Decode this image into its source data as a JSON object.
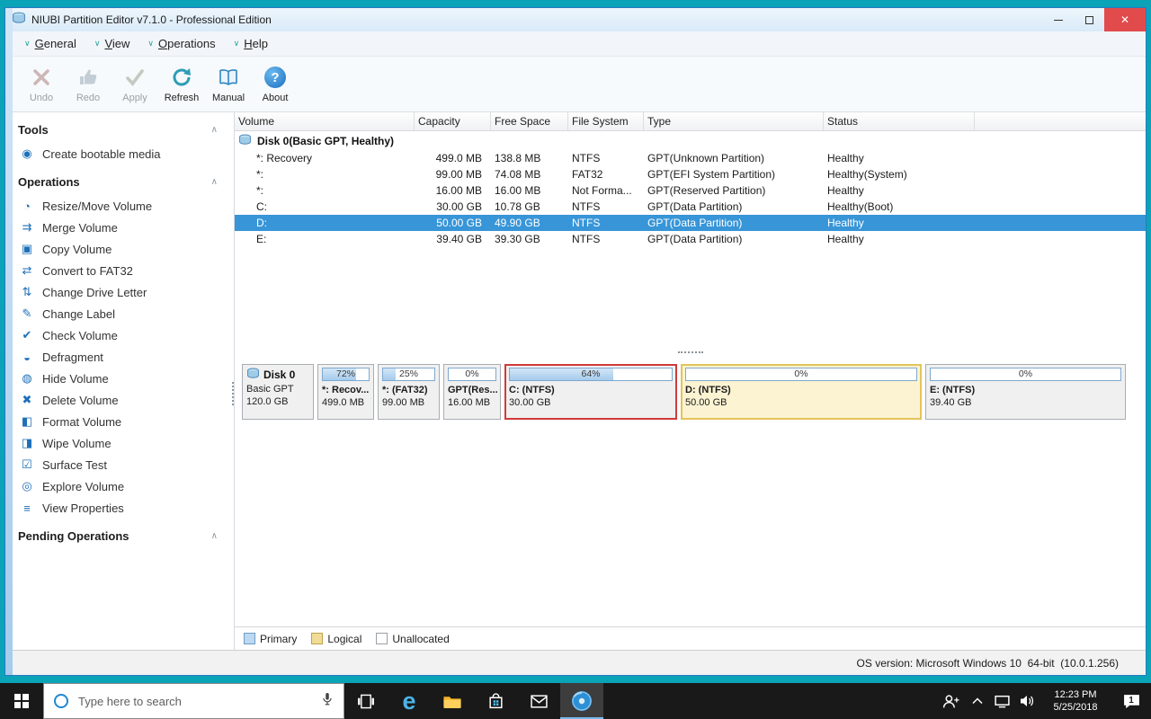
{
  "window": {
    "title": "NIUBI Partition Editor v7.1.0 - Professional Edition",
    "status_bar": "OS version: Microsoft Windows 10  64-bit  (10.0.1.256)"
  },
  "colors": {
    "selection_blue": "#3795d8",
    "desktop_teal": "#0ba3b8",
    "selected_block_border": "#cf3a3a",
    "logical_yellow": "#f0dc96",
    "primary_blue": "#bcd9f2",
    "close_red": "#e14b4b"
  },
  "icons": {
    "menu_chevron": "∨",
    "section_chevron": "∧",
    "close_glyph": "✕",
    "about_glyph": "?",
    "edge_glyph": "e"
  },
  "menu": [
    "General",
    "View",
    "Operations",
    "Help"
  ],
  "toolbar": [
    {
      "label": "Undo",
      "enabled": false
    },
    {
      "label": "Redo",
      "enabled": false
    },
    {
      "label": "Apply",
      "enabled": false
    },
    {
      "label": "Refresh",
      "enabled": true
    },
    {
      "label": "Manual",
      "enabled": true
    },
    {
      "label": "About",
      "enabled": true
    }
  ],
  "sidebar": {
    "sections": [
      {
        "title": "Tools",
        "items": [
          {
            "id": "create-bootable-media",
            "glyph": "◉",
            "label": "Create bootable media"
          }
        ]
      },
      {
        "title": "Operations",
        "items": [
          {
            "id": "resize-move-volume",
            "glyph": "◔",
            "label": "Resize/Move Volume"
          },
          {
            "id": "merge-volume",
            "glyph": "⇉",
            "label": "Merge Volume"
          },
          {
            "id": "copy-volume",
            "glyph": "▣",
            "label": "Copy Volume"
          },
          {
            "id": "convert-to-fat32",
            "glyph": "⇄",
            "label": "Convert to FAT32"
          },
          {
            "id": "change-drive-letter",
            "glyph": "⇅",
            "label": "Change Drive Letter"
          },
          {
            "id": "change-label",
            "glyph": "✎",
            "label": "Change Label"
          },
          {
            "id": "check-volume",
            "glyph": "✔",
            "label": "Check Volume"
          },
          {
            "id": "defragment",
            "glyph": "◒",
            "label": "Defragment"
          },
          {
            "id": "hide-volume",
            "glyph": "◍",
            "label": "Hide Volume"
          },
          {
            "id": "delete-volume",
            "glyph": "✖",
            "label": "Delete Volume"
          },
          {
            "id": "format-volume",
            "glyph": "◧",
            "label": "Format Volume"
          },
          {
            "id": "wipe-volume",
            "glyph": "◨",
            "label": "Wipe Volume"
          },
          {
            "id": "surface-test",
            "glyph": "☑",
            "label": "Surface Test"
          },
          {
            "id": "explore-volume",
            "glyph": "◎",
            "label": "Explore Volume"
          },
          {
            "id": "view-properties",
            "glyph": "≡",
            "label": "View Properties"
          }
        ]
      },
      {
        "title": "Pending Operations",
        "items": []
      }
    ]
  },
  "table": {
    "columns": [
      "Volume",
      "Capacity",
      "Free Space",
      "File System",
      "Type",
      "Status"
    ],
    "disk_group": "Disk 0(Basic GPT, Healthy)",
    "rows": [
      {
        "volume": "*: Recovery",
        "capacity": "499.0 MB",
        "free_space": "138.8 MB",
        "file_system": "NTFS",
        "type": "GPT(Unknown Partition)",
        "status": "Healthy",
        "selected": false
      },
      {
        "volume": "*:",
        "capacity": "99.00 MB",
        "free_space": "74.08 MB",
        "file_system": "FAT32",
        "type": "GPT(EFI System Partition)",
        "status": "Healthy(System)",
        "selected": false
      },
      {
        "volume": "*:",
        "capacity": "16.00 MB",
        "free_space": "16.00 MB",
        "file_system": "Not Forma...",
        "type": "GPT(Reserved Partition)",
        "status": "Healthy",
        "selected": false
      },
      {
        "volume": "C:",
        "capacity": "30.00 GB",
        "free_space": "10.78 GB",
        "file_system": "NTFS",
        "type": "GPT(Data Partition)",
        "status": "Healthy(Boot)",
        "selected": false
      },
      {
        "volume": "D:",
        "capacity": "50.00 GB",
        "free_space": "49.90 GB",
        "file_system": "NTFS",
        "type": "GPT(Data Partition)",
        "status": "Healthy",
        "selected": true
      },
      {
        "volume": "E:",
        "capacity": "39.40 GB",
        "free_space": "39.30 GB",
        "file_system": "NTFS",
        "type": "GPT(Data Partition)",
        "status": "Healthy",
        "selected": false
      }
    ]
  },
  "disk_map": {
    "disk": {
      "name": "Disk 0",
      "type": "Basic GPT",
      "size": "120.0 GB"
    },
    "partitions": [
      {
        "percent": "72%",
        "fill": "72%",
        "name": "*: Recov...",
        "size": "499.0 MB",
        "kind": "primary",
        "selected": false
      },
      {
        "percent": "25%",
        "fill": "25%",
        "name": "*: (FAT32)",
        "size": "99.00 MB",
        "kind": "primary",
        "selected": false
      },
      {
        "percent": "0%",
        "fill": "0%",
        "name": "GPT(Res...",
        "size": "16.00 MB",
        "kind": "primary",
        "selected": false
      },
      {
        "percent": "64%",
        "fill": "64%",
        "name": "C: (NTFS)",
        "size": "30.00 GB",
        "kind": "primary",
        "selected": true
      },
      {
        "percent": "0%",
        "fill": "0%",
        "name": "D: (NTFS)",
        "size": "50.00 GB",
        "kind": "logical",
        "selected": false
      },
      {
        "percent": "0%",
        "fill": "0%",
        "name": "E: (NTFS)",
        "size": "39.40 GB",
        "kind": "primary",
        "selected": false
      }
    ],
    "legend": [
      "Primary",
      "Logical",
      "Unallocated"
    ]
  },
  "taskbar": {
    "search_placeholder": "Type here to search",
    "clock": {
      "time": "12:23 PM",
      "date": "5/25/2018"
    },
    "notification_count": "1"
  }
}
